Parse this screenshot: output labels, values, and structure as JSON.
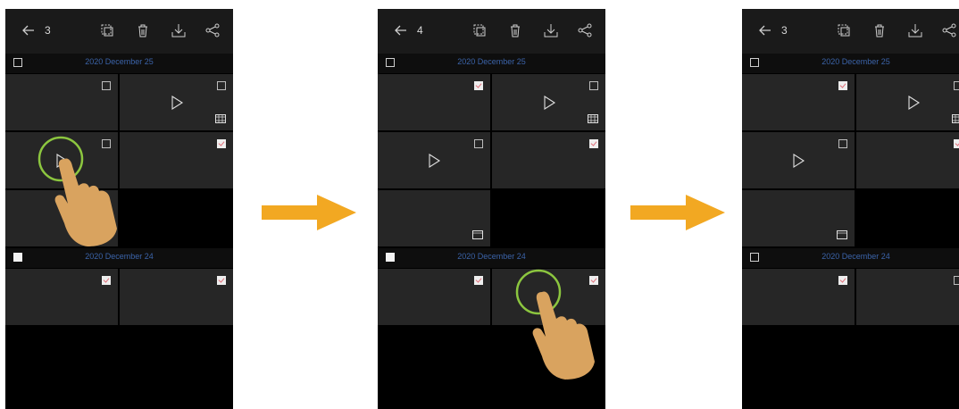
{
  "colors": {
    "accent_date": "#3b63a8",
    "arrow": "#f2a822",
    "tap_ring": "#8cc63f",
    "hand": "#d9a35f"
  },
  "icons": [
    "back-arrow-icon",
    "copy-icon",
    "trash-icon",
    "download-icon",
    "share-icon",
    "play-icon",
    "video-badge-icon",
    "checkbox-icon"
  ],
  "panels": [
    {
      "header": {
        "count": "3"
      },
      "sections": [
        {
          "date": "2020 December 25",
          "checked": false
        },
        {
          "date": "2020 December 24",
          "checked": true
        }
      ],
      "tiles": [
        {
          "checked": false,
          "play": false,
          "video_badge": false
        },
        {
          "checked": false,
          "play": true,
          "video_badge": true
        },
        {
          "checked": false,
          "play": true,
          "video_badge": false
        },
        {
          "checked": true,
          "play": false,
          "video_badge": false
        },
        {
          "checked": false,
          "play": false,
          "video_badge": true
        },
        {
          "checked": true,
          "play": false,
          "video_badge": false
        },
        {
          "checked": true,
          "play": false,
          "video_badge": false
        }
      ],
      "gesture": "tap on second-row first tile"
    },
    {
      "header": {
        "count": "4"
      },
      "sections": [
        {
          "date": "2020 December 25",
          "checked": false
        },
        {
          "date": "2020 December 24",
          "checked": true
        }
      ],
      "tiles": [
        {
          "checked": true,
          "play": false,
          "video_badge": false
        },
        {
          "checked": false,
          "play": true,
          "video_badge": true
        },
        {
          "checked": false,
          "play": true,
          "video_badge": false
        },
        {
          "checked": true,
          "play": false,
          "video_badge": false
        },
        {
          "checked": false,
          "play": false,
          "video_badge": true
        },
        {
          "checked": true,
          "play": false,
          "video_badge": false
        },
        {
          "checked": true,
          "play": false,
          "video_badge": false
        }
      ],
      "gesture": "tap on checked tile in Dec 24 section"
    },
    {
      "header": {
        "count": "3"
      },
      "sections": [
        {
          "date": "2020 December 25",
          "checked": false
        },
        {
          "date": "2020 December 24",
          "checked": false
        }
      ],
      "tiles": [
        {
          "checked": true,
          "play": false,
          "video_badge": false
        },
        {
          "checked": false,
          "play": true,
          "video_badge": true
        },
        {
          "checked": false,
          "play": true,
          "video_badge": false
        },
        {
          "checked": true,
          "play": false,
          "video_badge": false
        },
        {
          "checked": false,
          "play": false,
          "video_badge": true
        },
        {
          "checked": true,
          "play": false,
          "video_badge": false
        },
        {
          "checked": false,
          "play": false,
          "video_badge": false
        }
      ],
      "gesture": null
    }
  ]
}
